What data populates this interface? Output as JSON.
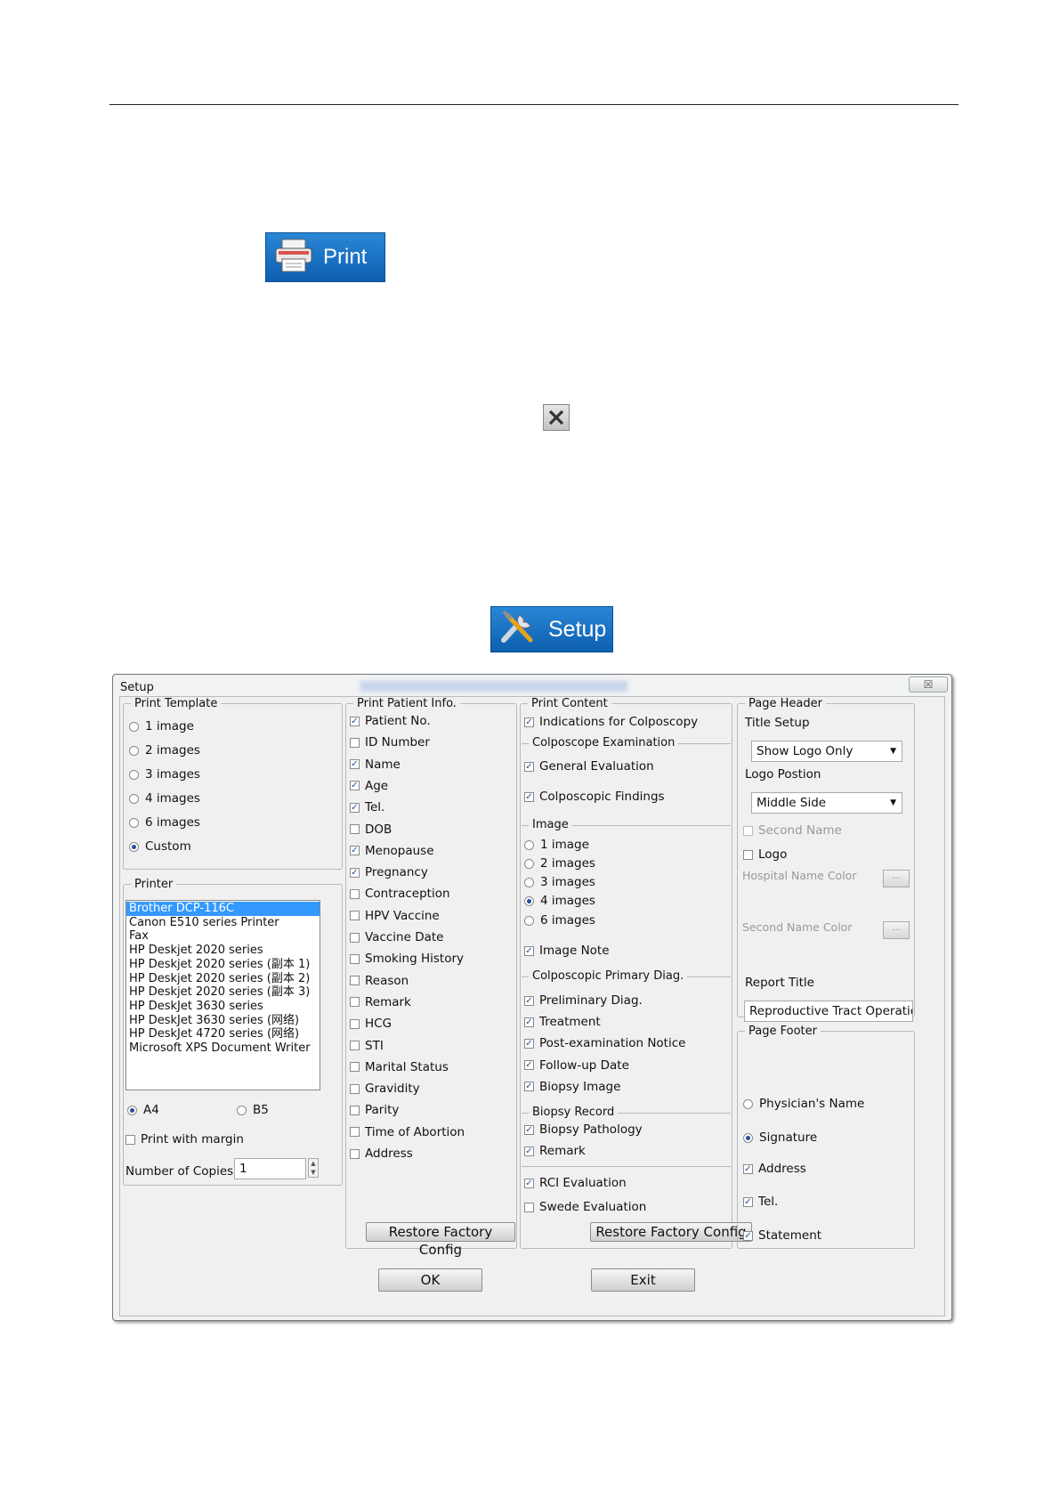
{
  "print_button": {
    "label": "Print"
  },
  "setup_button": {
    "label": "Setup"
  },
  "dialog": {
    "title": "Setup",
    "print_template": {
      "legend": "Print Template",
      "options": [
        "1 image",
        "2 images",
        "3 images",
        "4 images",
        "6 images",
        "Custom"
      ],
      "selected": "Custom"
    },
    "printer": {
      "legend": "Printer",
      "items": [
        "Brother DCP-116C",
        "Canon E510 series Printer",
        "Fax",
        "HP Deskjet 2020 series",
        "HP Deskjet 2020 series (副本 1)",
        "HP Deskjet 2020 series (副本 2)",
        "HP Deskjet 2020 series (副本 3)",
        "HP DeskJet 3630 series",
        "HP DeskJet 3630 series (网络)",
        "HP DeskJet 4720 series (网络)",
        "Microsoft XPS Document Writer"
      ],
      "selected": "Brother DCP-116C",
      "paper_a4": "A4",
      "paper_b5": "B5",
      "paper_selected": "A4",
      "print_with_margin": "Print with margin",
      "copies_label": "Number of Copies",
      "copies_value": "1"
    },
    "patient_info": {
      "legend": "Print Patient Info.",
      "items": [
        {
          "label": "Patient No.",
          "checked": true
        },
        {
          "label": "ID Number",
          "checked": false
        },
        {
          "label": "Name",
          "checked": true
        },
        {
          "label": "Age",
          "checked": true
        },
        {
          "label": "Tel.",
          "checked": true
        },
        {
          "label": "DOB",
          "checked": false
        },
        {
          "label": "Menopause",
          "checked": true
        },
        {
          "label": "Pregnancy",
          "checked": true
        },
        {
          "label": "Contraception",
          "checked": false
        },
        {
          "label": "HPV Vaccine",
          "checked": false
        },
        {
          "label": "Vaccine Date",
          "checked": false
        },
        {
          "label": "Smoking History",
          "checked": false
        },
        {
          "label": "Reason",
          "checked": false
        },
        {
          "label": "Remark",
          "checked": false
        },
        {
          "label": "HCG",
          "checked": false
        },
        {
          "label": "STI",
          "checked": false
        },
        {
          "label": "Marital Status",
          "checked": false
        },
        {
          "label": "Gravidity",
          "checked": false
        },
        {
          "label": "Parity",
          "checked": false
        },
        {
          "label": "Time of Abortion",
          "checked": false
        },
        {
          "label": "Address",
          "checked": false
        }
      ],
      "restore_label": "Restore Factory Config"
    },
    "print_content": {
      "legend": "Print Content",
      "indications": "Indications for Colposcopy",
      "exam_header": "Colposcope Examination",
      "general_eval": "General Evaluation",
      "findings": "Colposcopic Findings",
      "image_header": "Image",
      "image_options": [
        "1 image",
        "2 images",
        "3 images",
        "4 images",
        "6 images"
      ],
      "image_selected": "4 images",
      "image_note": "Image Note",
      "diag_header": "Colposcopic Primary Diag.",
      "diag_items": [
        "Preliminary Diag.",
        "Treatment",
        "Post-examination Notice",
        "Follow-up Date",
        "Biopsy Image"
      ],
      "biopsy_header": "Biopsy Record",
      "biopsy_items": [
        "Biopsy Pathology",
        "Remark"
      ],
      "rci": "RCI Evaluation",
      "swede": "Swede Evaluation",
      "restore_label": "Restore Factory Config"
    },
    "page_header": {
      "legend": "Page Header",
      "title_setup": "Title Setup",
      "title_value": "Show Logo Only",
      "logo_position_label": "Logo Postion",
      "logo_position_value": "Middle Side",
      "second_name": "Second Name",
      "logo": "Logo",
      "hospital_name_color": "Hospital Name Color",
      "second_name_color": "Second Name Color",
      "dots": "...",
      "report_title_label": "Report Title",
      "report_title_value": "Reproductive Tract Operatio"
    },
    "page_footer": {
      "legend": "Page Footer",
      "physician": "Physician's Name",
      "signature": "Signature",
      "footer_selected": "Signature",
      "address": "Address",
      "tel": "Tel.",
      "statement": "Statement"
    },
    "ok_label": "OK",
    "exit_label": "Exit",
    "close_glyph": "☒"
  }
}
